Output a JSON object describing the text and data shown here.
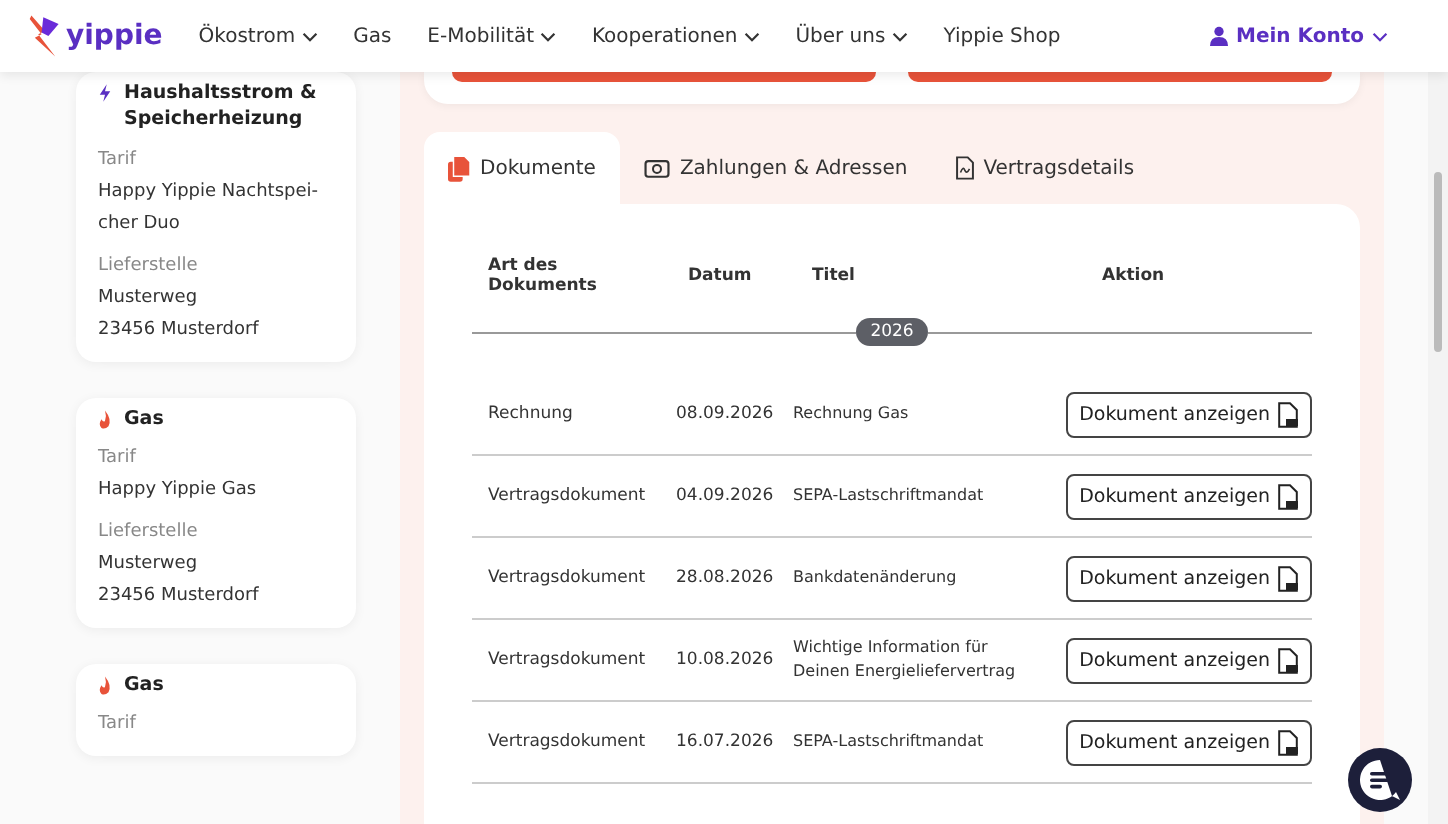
{
  "nav": {
    "logo": "yippie",
    "items": [
      {
        "label": "Ökostrom",
        "dropdown": true
      },
      {
        "label": "Gas",
        "dropdown": false
      },
      {
        "label": "E-Mobilität",
        "dropdown": true
      },
      {
        "label": "Kooperationen",
        "dropdown": true
      },
      {
        "label": "Über uns",
        "dropdown": true
      },
      {
        "label": "Yippie Shop",
        "dropdown": false
      }
    ],
    "account": "Mein Konto"
  },
  "contracts": [
    {
      "kind": "electricity",
      "title": "Haushaltsstrom & Speicherheizung",
      "tariff_label": "Tarif",
      "tariff": "Happy Yippie Nachtspei-cher Duo",
      "site_label": "Lieferstelle",
      "street": "Musterweg",
      "city": "23456 Musterdorf"
    },
    {
      "kind": "gas",
      "title": "Gas",
      "tariff_label": "Tarif",
      "tariff": "Happy Yippie Gas",
      "site_label": "Lieferstelle",
      "street": "Musterweg",
      "city": "23456 Musterdorf"
    },
    {
      "kind": "gas",
      "title": "Gas",
      "tariff_label": "Tarif"
    }
  ],
  "tabs": [
    {
      "label": "Dokumente",
      "kind": "documents",
      "selected": true
    },
    {
      "label": "Zahlungen & Adressen",
      "kind": "money",
      "selected": false
    },
    {
      "label": "Vertragsdetails",
      "kind": "file",
      "selected": false
    }
  ],
  "table": {
    "columns": [
      "Art des Dokuments",
      "Datum",
      "Titel",
      "Aktion"
    ],
    "year": "2026",
    "rows": [
      {
        "type": "Rechnung",
        "date": "08.09.2026",
        "title": "Rechnung Gas",
        "action": "Dokument anzeigen"
      },
      {
        "type": "Vertragsdokument",
        "date": "04.09.2026",
        "title": "SEPA-Lastschriftmandat",
        "action": "Dokument anzeigen"
      },
      {
        "type": "Vertragsdokument",
        "date": "28.08.2026",
        "title": "Bankdatenänderung",
        "action": "Dokument anzeigen"
      },
      {
        "type": "Vertragsdokument",
        "date": "10.08.2026",
        "title": "Wichtige Information für Deinen Energieliefervertrag",
        "action": "Dokument anzeigen"
      },
      {
        "type": "Vertragsdokument",
        "date": "16.07.2026",
        "title": "SEPA-Lastschriftmandat",
        "action": "Dokument anzeigen"
      }
    ]
  }
}
